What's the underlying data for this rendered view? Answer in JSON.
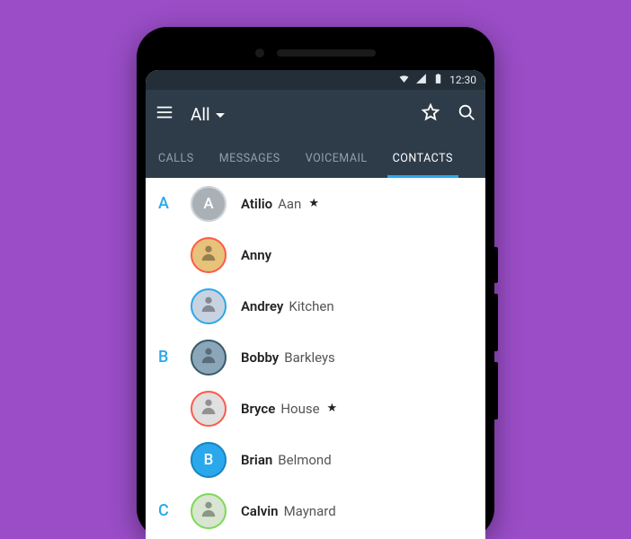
{
  "statusbar": {
    "time": "12:30"
  },
  "appbar": {
    "filter_label": "All"
  },
  "tabs": [
    {
      "label": "CALLS",
      "active": false
    },
    {
      "label": "MESSAGES",
      "active": false
    },
    {
      "label": "VOICEMAIL",
      "active": false
    },
    {
      "label": "CONTACTS",
      "active": true
    }
  ],
  "contacts": [
    {
      "section": "A",
      "first": "Atilio",
      "last": "Aan",
      "starred": true,
      "avatar": {
        "type": "letter",
        "letter": "A",
        "bg": "#a9b0b6",
        "ring": "#d0d6da"
      }
    },
    {
      "section": "",
      "first": "Anny",
      "last": "",
      "starred": false,
      "avatar": {
        "type": "photo",
        "bg": "#e6c27a",
        "ring": "#ff5a4a"
      }
    },
    {
      "section": "",
      "first": "Andrey",
      "last": "Kitchen",
      "starred": false,
      "avatar": {
        "type": "photo",
        "bg": "#c8d3e2",
        "ring": "#2aa8ec"
      }
    },
    {
      "section": "B",
      "first": "Bobby",
      "last": "Barkleys",
      "starred": false,
      "avatar": {
        "type": "photo",
        "bg": "#8aa6b8",
        "ring": "#3a5a6a"
      }
    },
    {
      "section": "",
      "first": "Bryce",
      "last": "House",
      "starred": true,
      "avatar": {
        "type": "photo",
        "bg": "#e0e0e0",
        "ring": "#ff5a4a"
      }
    },
    {
      "section": "",
      "first": "Brian",
      "last": "Belmond",
      "starred": false,
      "avatar": {
        "type": "letter",
        "letter": "B",
        "bg": "#2aa8ec",
        "ring": "#1b85c2"
      }
    },
    {
      "section": "C",
      "first": "Calvin",
      "last": "Maynard",
      "starred": false,
      "avatar": {
        "type": "photo",
        "bg": "#d8e5d0",
        "ring": "#7ed957"
      }
    }
  ]
}
